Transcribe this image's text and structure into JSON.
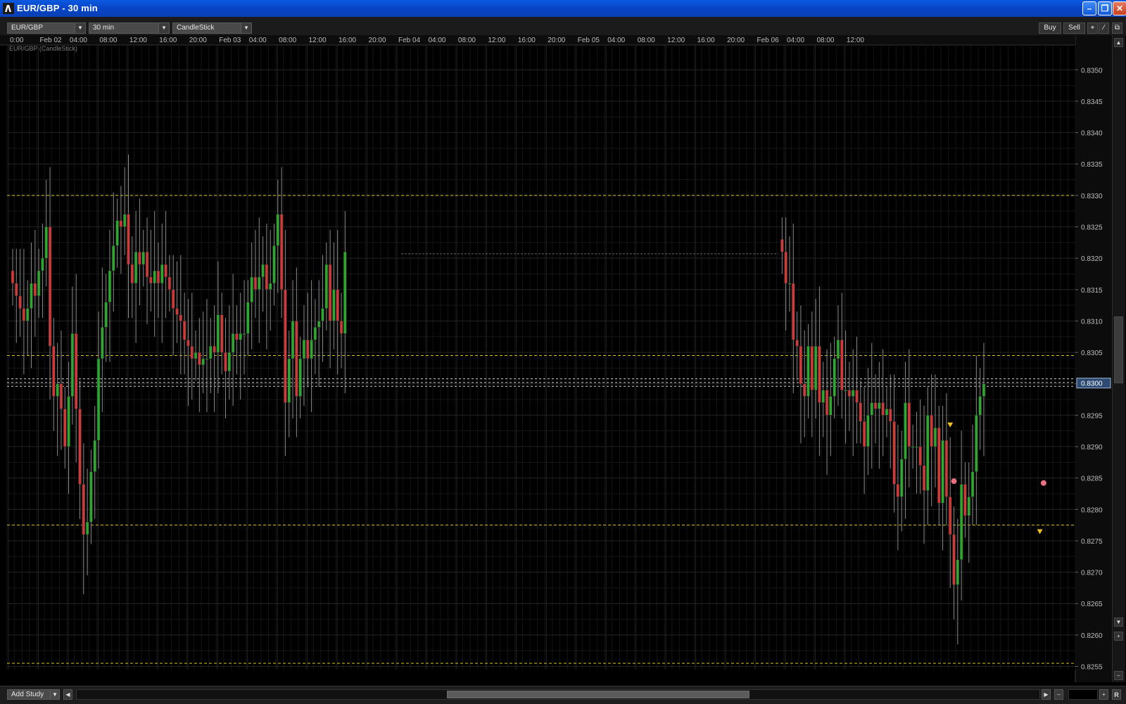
{
  "window": {
    "title": "EUR/GBP - 30 min"
  },
  "toolbar": {
    "symbol": "EUR/GBP",
    "period": "30 min",
    "chart_type": "CandleStick",
    "buy_label": "Buy",
    "sell_label": "Sell"
  },
  "chart_label": "EUR/GBP (CandleStick)",
  "current_price": "0.8300",
  "colors": {
    "up": "#2fa82f",
    "down": "#d03a3a",
    "grid": "#222222",
    "level_line": "#d7c220",
    "background": "#000000"
  },
  "bottom": {
    "add_study_label": "Add Study",
    "reset_label": "R"
  },
  "chart_data": {
    "type": "candlestick",
    "title": "EUR/GBP (CandleStick)",
    "x_ticks": [
      "0:00",
      "Feb 02",
      "04:00",
      "08:00",
      "12:00",
      "16:00",
      "20:00",
      "Feb 03",
      "04:00",
      "08:00",
      "12:00",
      "16:00",
      "20:00",
      "Feb 04",
      "04:00",
      "08:00",
      "12:00",
      "16:00",
      "20:00",
      "Feb 05",
      "04:00",
      "08:00",
      "12:00",
      "16:00",
      "20:00",
      "Feb 06",
      "04:00",
      "08:00",
      "12:00"
    ],
    "y_ticks": [
      "0.8350",
      "0.8345",
      "0.8340",
      "0.8335",
      "0.8330",
      "0.8325",
      "0.8320",
      "0.8315",
      "0.8310",
      "0.8305",
      "0.8300",
      "0.8295",
      "0.8290",
      "0.8285",
      "0.8280",
      "0.8275",
      "0.8270",
      "0.8265",
      "0.8260",
      "0.8255"
    ],
    "ylim": [
      0.82545,
      0.83535
    ],
    "horizontal_levels": [
      0.833,
      0.83045,
      0.82775,
      0.82555
    ],
    "current_price_lines": [
      0.83008,
      0.83002,
      0.82996
    ],
    "segments": [
      {
        "start": 1,
        "closes": [
          0.8316,
          0.8314,
          0.8312,
          0.831,
          0.8312,
          0.8316,
          0.8314,
          0.8318,
          0.832,
          0.8325,
          0.8306,
          0.8298,
          0.83,
          0.8296,
          0.829,
          0.8298,
          0.8308,
          0.8296,
          0.8284,
          0.8276,
          0.8278,
          0.8286,
          0.8291,
          0.8304,
          0.8309,
          0.8313,
          0.8318,
          0.8322,
          0.8326,
          0.8325,
          0.8327,
          0.8319,
          0.8316,
          0.8321,
          0.8319,
          0.8321,
          0.8317,
          0.8316,
          0.8318,
          0.8316,
          0.8319,
          0.8317,
          0.8315,
          0.8312,
          0.8311,
          0.831,
          0.8307,
          0.8306,
          0.8304,
          0.8305,
          0.8303,
          0.8304,
          0.8304,
          0.8306,
          0.8305,
          0.8311,
          0.8305,
          0.8302,
          0.8305,
          0.8308,
          0.8307,
          0.8308,
          0.8308,
          0.8313,
          0.8317,
          0.8315,
          0.8317,
          0.8319,
          0.8315,
          0.8316,
          0.8322,
          0.8327,
          0.8315,
          0.8297,
          0.8304,
          0.831,
          0.8298,
          0.8304,
          0.8307,
          0.8304,
          0.8307,
          0.8309,
          0.831,
          0.8312,
          0.8319,
          0.831,
          0.8315,
          0.831,
          0.8308,
          0.8321
        ]
      },
      {
        "start": 207,
        "closes": [
          0.8321,
          0.8316,
          0.8316,
          0.8307,
          0.8306,
          0.83,
          0.8298,
          0.8306,
          0.8299,
          0.8306,
          0.8297,
          0.8299,
          0.8295,
          0.8298,
          0.8304,
          0.8307,
          0.8299,
          0.8299,
          0.8298,
          0.8299,
          0.8297,
          0.8294,
          0.829,
          0.8295,
          0.8297,
          0.8296,
          0.8297,
          0.8295,
          0.8296,
          0.8294,
          0.8284,
          0.8282,
          0.8288,
          0.8297,
          0.829,
          0.829,
          0.829,
          0.8287,
          0.8283,
          0.8295,
          0.829,
          0.8293,
          0.8281,
          0.8291,
          0.8282,
          0.8276,
          0.8268,
          0.8272,
          0.8284,
          0.8279,
          0.8282,
          0.8286,
          0.8295,
          0.8298,
          0.83
        ]
      }
    ],
    "markers": [
      {
        "type": "triangle",
        "index": 252,
        "price": 0.82935,
        "color": "#f0c020"
      },
      {
        "type": "circle",
        "index": 253,
        "price": 0.82845,
        "color": "#e87080"
      },
      {
        "type": "circle",
        "index": 277,
        "price": 0.82842,
        "color": "#e87080"
      },
      {
        "type": "triangle",
        "index": 276,
        "price": 0.82765,
        "color": "#f0c020"
      }
    ],
    "flat_line": {
      "from_index": 105,
      "to_index": 206,
      "price": 0.83207
    }
  }
}
